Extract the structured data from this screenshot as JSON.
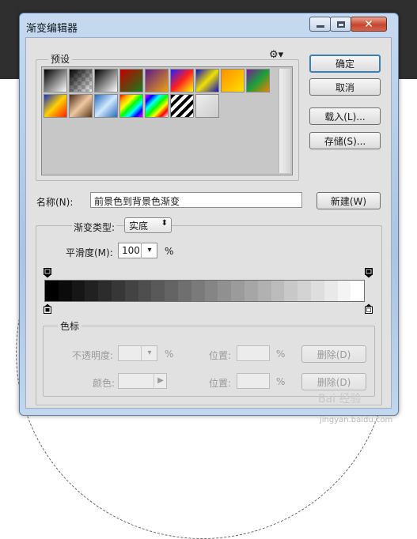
{
  "window": {
    "title": "渐变编辑器"
  },
  "titlebar_buttons": {
    "close_glyph": "✕"
  },
  "presets": {
    "label": "预设",
    "menu_glyph": "⚙▾",
    "swatches": [
      "linear-gradient(135deg,#000,#fff)",
      "linear-gradient(135deg,#000,rgba(0,0,0,0.05))",
      "linear-gradient(135deg,#000,#fff)",
      "linear-gradient(135deg,#c00000,#1a7a1a)",
      "linear-gradient(135deg,#5a1a8a,#f0a010)",
      "linear-gradient(135deg,#2020ff,#ff2020,#ffff00)",
      "linear-gradient(135deg,#1010c0,#f0e000,#1010c0)",
      "linear-gradient(135deg,#ff9000,#ffe000)",
      "linear-gradient(135deg,#7a1a9a,#1aa03a,#f08000)",
      "linear-gradient(135deg,#1530c0,#ffd000,#ff2000)",
      "linear-gradient(135deg,#4a2c1c,#f0c8a0,#5a3a20)",
      "linear-gradient(135deg,#2a6ab8,#cfe8ff,#2a6ab8)",
      "linear-gradient(135deg,red,orange,yellow,lime,cyan,blue,magenta)",
      "linear-gradient(135deg,magenta,blue,cyan,lime,yellow,red,white)",
      "repeating-linear-gradient(135deg,#000 0 4px,#fff 4px 8px)",
      "linear-gradient(135deg,#eee,#ccc)"
    ]
  },
  "buttons": {
    "ok": "确定",
    "cancel": "取消",
    "load": "载入(L)...",
    "save": "存储(S)...",
    "new": "新建(W)"
  },
  "name": {
    "label": "名称(N):",
    "value": "前景色到背景色渐变"
  },
  "gradient_type": {
    "label": "渐变类型:",
    "value": "实底",
    "arrow": "⬍"
  },
  "smoothness": {
    "label": "平滑度(M):",
    "value": "100",
    "unit": "%",
    "arrow": "▾"
  },
  "colorstops": {
    "label": "色标",
    "opacity_label": "不透明度:",
    "opacity_unit": "%",
    "color_label": "颜色:",
    "location_label": "位置:",
    "location_unit": "%",
    "delete": "删除(D)",
    "arrow": "▾",
    "color_arrow": "▶"
  },
  "gradient": {
    "from": "#000000",
    "to": "#ffffff",
    "steps": 24
  },
  "watermark": {
    "brand": "Bai 经验",
    "url": "jingyan.baidu.com"
  }
}
